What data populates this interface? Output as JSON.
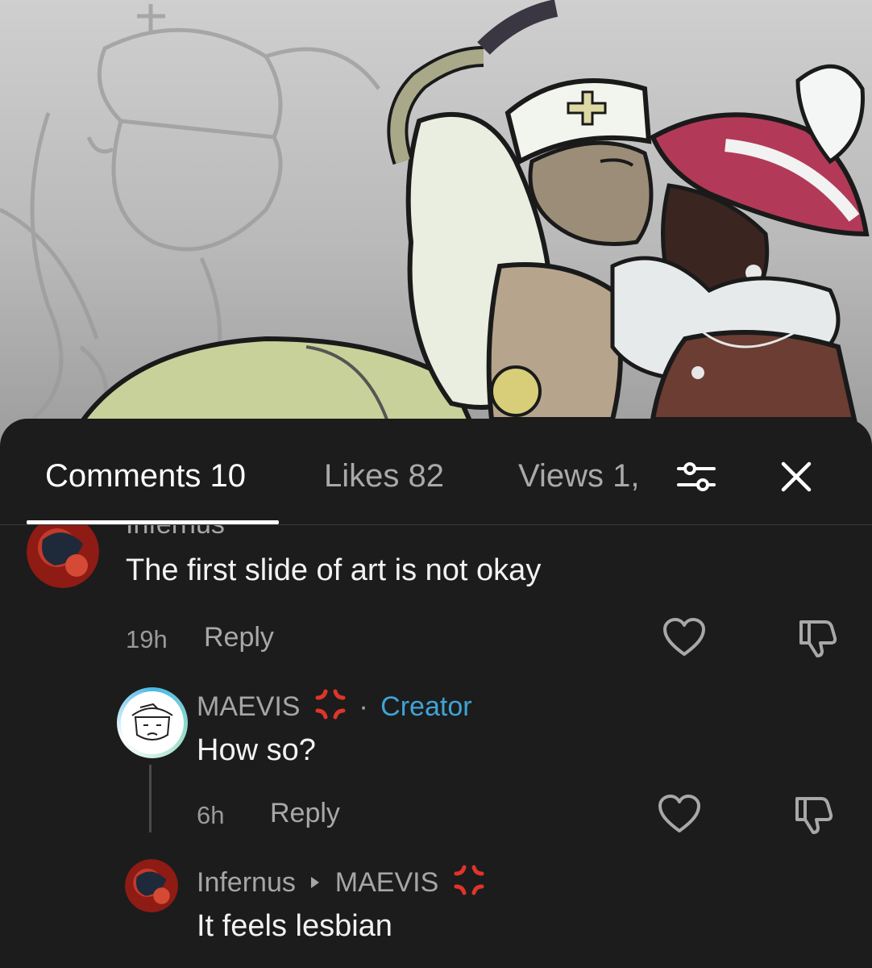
{
  "tabs": {
    "comments_label": "Comments 10",
    "likes_label": "Likes 82",
    "views_label": "Views 1,"
  },
  "icons": {
    "filter": "sliders-icon",
    "close": "close-icon",
    "like": "heart-icon",
    "dislike": "thumbs-down-icon",
    "badge": "anger-symbol-icon",
    "reply_arrow": "triangle-right-icon"
  },
  "colors": {
    "sheet_background": "#1c1c1c",
    "creator_label": "#3ea4d6",
    "badge": "#e0342b",
    "creator_ring": "#49b8e6"
  },
  "comments": [
    {
      "username": "Infernus",
      "text": "The first slide of art is not okay",
      "time": "19h",
      "reply_label": "Reply"
    },
    {
      "username": "MAEVIS",
      "separator": "·",
      "role": "Creator",
      "text": "How so?",
      "time": "6h",
      "reply_label": "Reply"
    },
    {
      "username": "Infernus",
      "reply_to": "MAEVIS",
      "text": "It feels lesbian"
    }
  ]
}
